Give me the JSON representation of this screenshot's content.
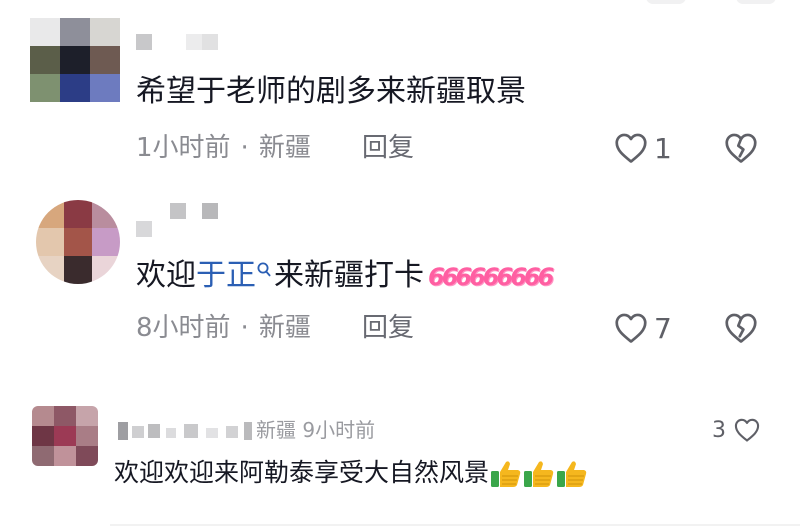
{
  "comments": [
    {
      "text": "希望于老师的剧多来新疆取景",
      "time": "1小时前",
      "separator": "·",
      "location": "新疆",
      "reply_label": "回复",
      "like_count": "1"
    },
    {
      "text_prefix": "欢迎",
      "mention": "于正",
      "text_suffix": "来新疆打卡",
      "emoji_text": "666666666",
      "time": "8小时前",
      "separator": "·",
      "location": "新疆",
      "reply_label": "回复",
      "like_count": "7"
    },
    {
      "partial_meta": "新疆 9小时前",
      "text": "欢迎欢迎来阿勒泰享受大自然风景",
      "like_count": "3"
    }
  ],
  "colors": {
    "text_primary": "#161823",
    "text_secondary": "#8a8b91",
    "mention": "#2b5fb4",
    "emoji_pink": "#ff5fa2",
    "thumb_yellow": "#f5b71e",
    "thumb_green": "#3aa64a"
  },
  "icons": {
    "like": "heart-outline-icon",
    "dislike": "broken-heart-icon",
    "mention": "search-icon",
    "thumbs_up": "thumbs-up-emoji"
  }
}
